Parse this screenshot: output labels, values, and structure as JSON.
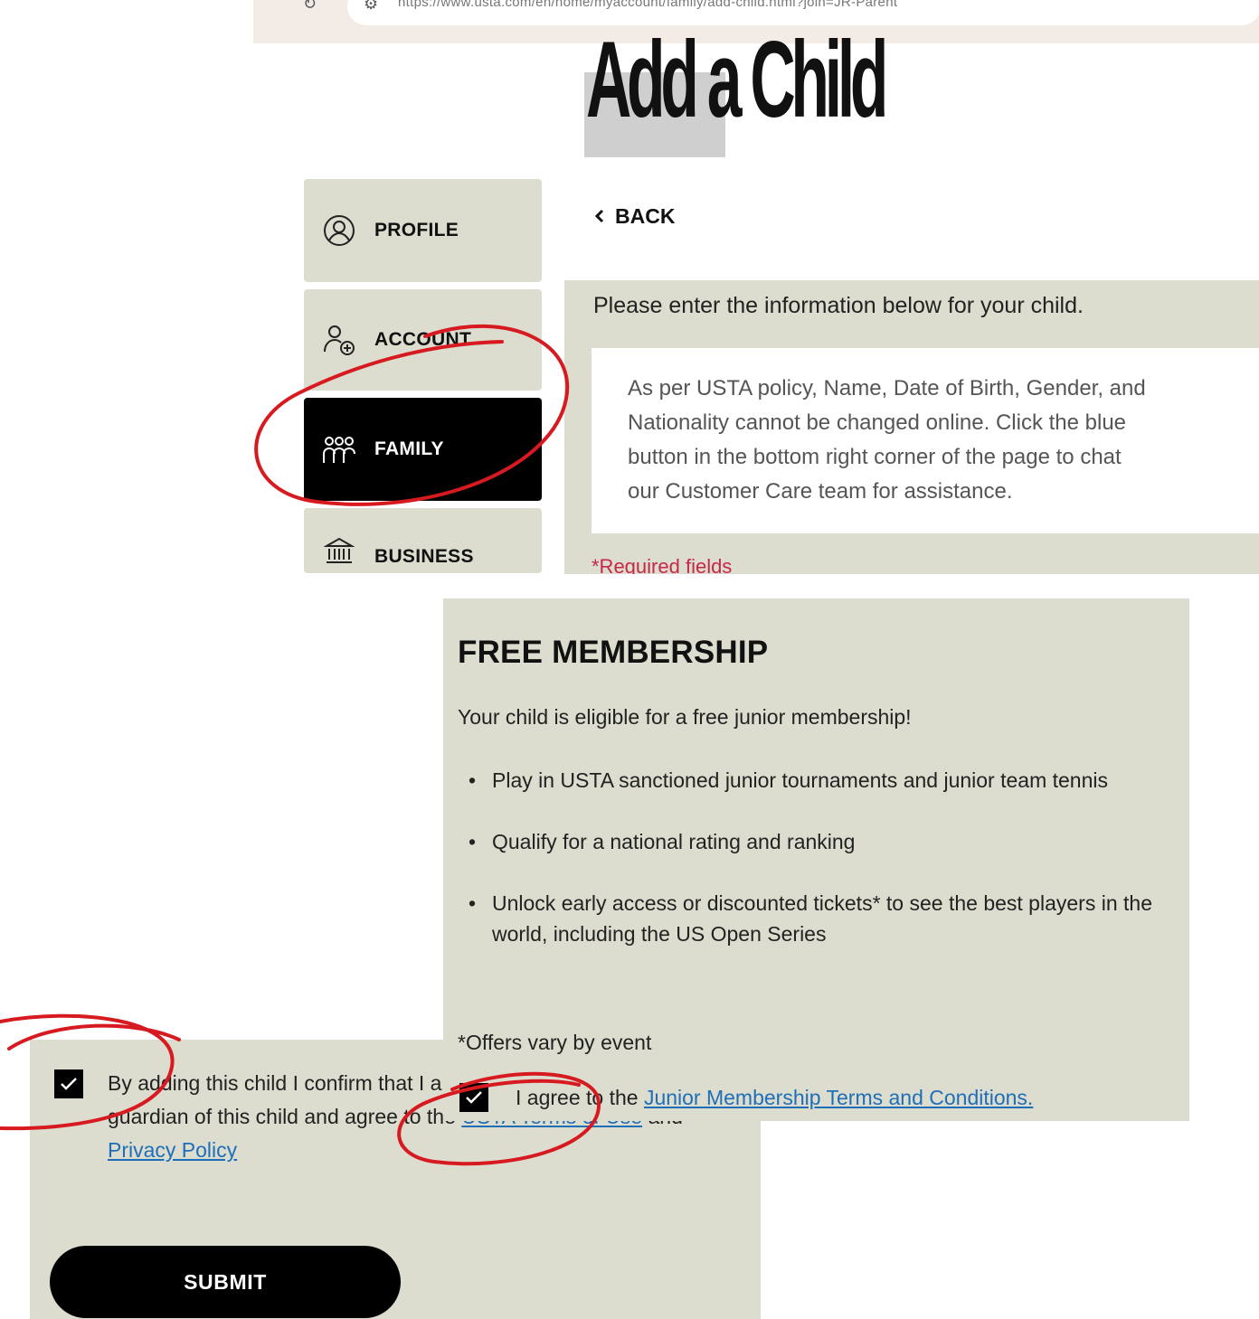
{
  "browser": {
    "url": "https://www.usta.com/en/home/myaccount/family/add-child.html?join=JR-Parent"
  },
  "page": {
    "title_part1": "Add",
    "title_part2": "a Child"
  },
  "sidebar": {
    "items": [
      {
        "label": "PROFILE",
        "icon": "profile-icon"
      },
      {
        "label": "ACCOUNT",
        "icon": "add-user-icon"
      },
      {
        "label": "FAMILY",
        "icon": "family-icon",
        "active": true
      },
      {
        "label": "BUSINESS",
        "icon": "bank-icon"
      }
    ]
  },
  "form": {
    "back_label": "BACK",
    "intro": "Please enter the information below for your child.",
    "notice_lines": [
      "As per USTA policy, Name, Date of Birth, Gender, and",
      "Nationality cannot be changed online. Click the blue",
      "button in the bottom right corner of the page to chat",
      "our Customer Care team for assistance."
    ],
    "required_note": "*Required fields"
  },
  "membership": {
    "title": "FREE MEMBERSHIP",
    "subtitle": "Your child is eligible for a free junior membership!",
    "benefits": [
      "Play in USTA sanctioned junior tournaments and junior team tennis",
      "Qualify for a national rating and ranking",
      "Unlock early access or discounted tickets* to see the best players in the world, including the US Open Series"
    ],
    "offers_note": "*Offers vary by event",
    "agree_prefix": "I agree to the",
    "agree_link": "Junior Membership Terms and Conditions.",
    "agree_checked": true
  },
  "consent": {
    "checked": true,
    "text_prefix": "By adding this child I confirm that I am the parent or legal guardian of this child and agree to the",
    "terms_link": "USTA Terms of Use",
    "and_text": "and",
    "privacy_link": "Privacy Policy"
  },
  "submit_label": "SUBMIT",
  "colors": {
    "panel_bg": "#dcdccf",
    "active_nav": "#000000",
    "link": "#1e6fb8",
    "required": "#c62848",
    "annotation": "#d71920"
  }
}
